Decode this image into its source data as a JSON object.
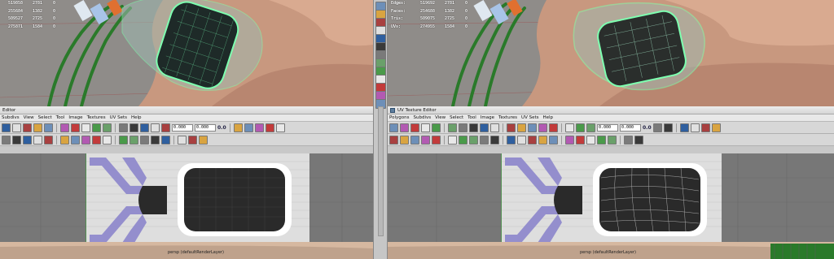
{
  "left_panel": {
    "stats_rows": [
      {
        "label": "",
        "v1": "519858",
        "v2": "2781",
        "v3": "0",
        "v4": ""
      },
      {
        "label": "",
        "v1": "255684",
        "v2": "1382",
        "v3": "0",
        "v4": ""
      },
      {
        "label": "",
        "v1": "509527",
        "v2": "2725",
        "v3": "0",
        "v4": ""
      },
      {
        "label": "",
        "v1": "275871",
        "v2": "1584",
        "v3": "0",
        "v4": ""
      }
    ],
    "editor_title": "Editor",
    "menu": [
      "Subdivs",
      "View",
      "Select",
      "Tool",
      "Image",
      "Textures",
      "UV Sets",
      "Help"
    ],
    "field_u": "0.000",
    "field_v": "0.000",
    "readout": "0.0",
    "status_text": "persp (defaultRenderLayer)"
  },
  "right_panel": {
    "stats_rows": [
      {
        "label": "Edges:",
        "v1": "519692",
        "v2": "2781",
        "v3": "0",
        "v4": ""
      },
      {
        "label": "Faces:",
        "v1": "254688",
        "v2": "1382",
        "v3": "0",
        "v4": ""
      },
      {
        "label": "Tris:",
        "v1": "509075",
        "v2": "2725",
        "v3": "0",
        "v4": ""
      },
      {
        "label": "UVs:",
        "v1": "274955",
        "v2": "1584",
        "v3": "0",
        "v4": ""
      }
    ],
    "editor_title": "UV Texture Editor",
    "menu": [
      "Polygons",
      "Subdivs",
      "View",
      "Select",
      "Tool",
      "Image",
      "Textures",
      "UV Sets",
      "Help"
    ],
    "field_u": "0.000",
    "field_v": "0.000",
    "readout": "0.0",
    "status_text": "persp (defaultRenderLayer)"
  },
  "colors": {
    "skin": "#c49780",
    "wire_green": "#7effb0",
    "cable_green": "#2d7a2d",
    "uv_checker": "#2a2a2a",
    "uv_purple": "#8c86cc",
    "grid_bg": "#777777"
  },
  "icons": {
    "divider_shelf": [
      "select-tool-icon",
      "lasso-icon",
      "paint-icon",
      "move-icon",
      "rotate-icon",
      "scale-icon",
      "soft-mod-icon",
      "render-icon",
      "snapshot-icon",
      "layout-icon",
      "outliner-icon",
      "graph-icon",
      "hypershade-icon"
    ]
  }
}
